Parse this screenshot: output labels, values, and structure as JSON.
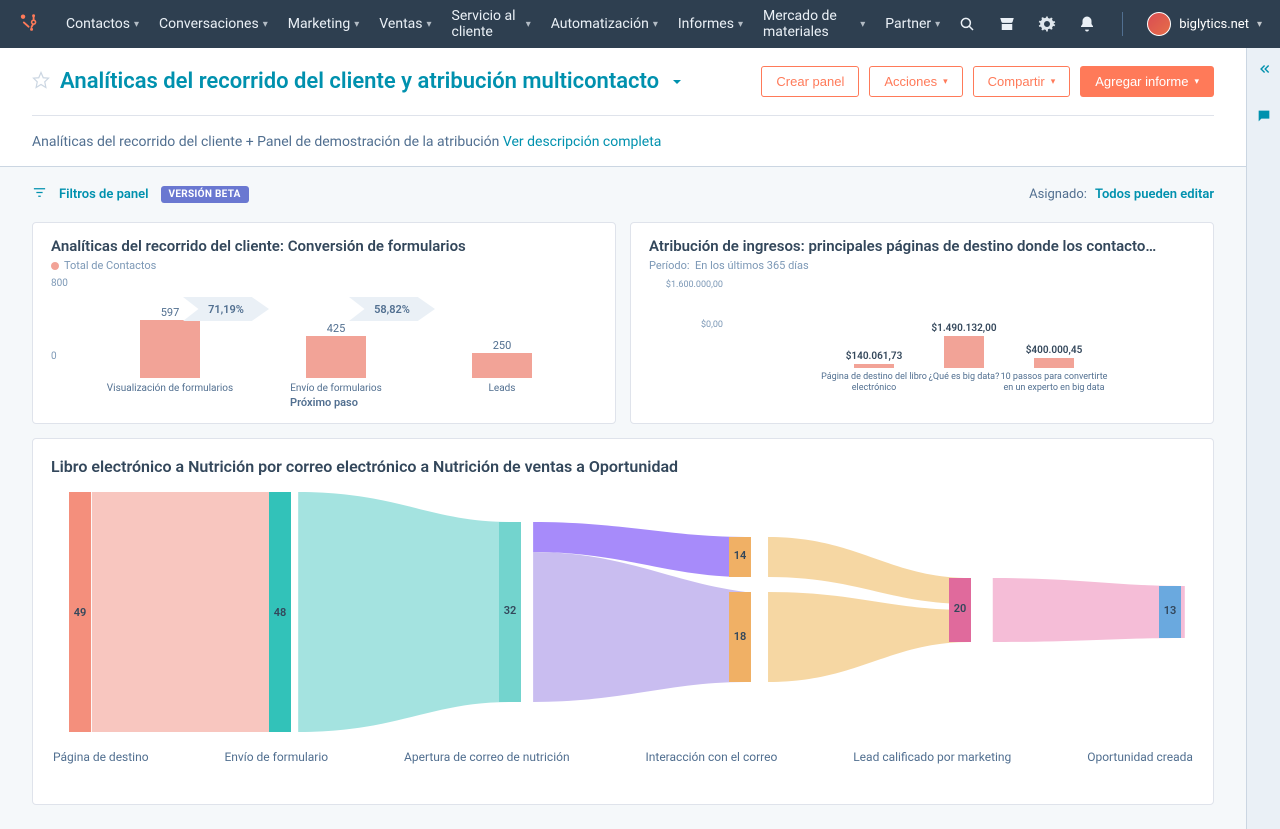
{
  "nav": {
    "items": [
      "Contactos",
      "Conversaciones",
      "Marketing",
      "Ventas",
      "Servicio al cliente",
      "Automatización",
      "Informes",
      "Mercado de materiales",
      "Partner"
    ],
    "account": "biglytics.net"
  },
  "header": {
    "title": "Analíticas del recorrido del cliente y atribución multicontacto",
    "buttons": {
      "create": "Crear panel",
      "actions": "Acciones",
      "share": "Compartir",
      "add_report": "Agregar informe"
    },
    "desc_prefix": "Analíticas del recorrido del cliente + Panel de demostración de la atribución ",
    "desc_link": "Ver descripción completa"
  },
  "filters": {
    "label": "Filtros de panel",
    "badge": "VERSIÓN BETA",
    "assigned_label": "Asignado:",
    "assigned_value": "Todos pueden editar"
  },
  "card1": {
    "title": "Analíticas del recorrido del cliente: Conversión de formularios",
    "legend": "Total de Contactos",
    "axis_max": "800",
    "axis_min": "0",
    "xaxis_title": "Próximo paso"
  },
  "card2": {
    "title": "Atribución de ingresos: principales páginas de destino donde los contacto…",
    "period_label": "Período:",
    "period_value": "En los últimos 365 días",
    "axis_top": "$1.600.000,00",
    "axis_bot": "$0,00"
  },
  "sankey": {
    "title": "Libro electrónico a Nutrición por correo electrónico a Nutrición de ventas a Oportunidad",
    "labels": [
      "Página de destino",
      "Envío de formulario",
      "Apertura de correo de nutrición",
      "Interacción con el correo",
      "Lead calificado por marketing",
      "Oportunidad creada"
    ]
  },
  "chart_data": [
    {
      "type": "bar",
      "title": "Analíticas del recorrido del cliente: Conversión de formularios",
      "ylabel": "Total de Contactos",
      "xlabel": "Próximo paso",
      "ylim": [
        0,
        800
      ],
      "categories": [
        "Visualización de formularios",
        "Envío de formularios",
        "Leads"
      ],
      "values": [
        597,
        425,
        250
      ],
      "conversion_rates": [
        "71,19%",
        "58,82%"
      ]
    },
    {
      "type": "bar",
      "title": "Atribución de ingresos: principales páginas de destino donde los contactos…",
      "period": "En los últimos 365 días",
      "ylim": [
        0,
        1600000
      ],
      "categories": [
        "Página de destino del libro electrónico",
        "¿Qué es big data?",
        "10 passos para convertirte en un experto en big data"
      ],
      "values_label": [
        "$140.061,73",
        "$1.490.132,00",
        "$400.000,45"
      ],
      "values": [
        140061.73,
        1490132.0,
        400000.45
      ]
    },
    {
      "type": "sankey",
      "title": "Libro electrónico a Nutrición por correo electrónico a Nutrición de ventas a Oportunidad",
      "nodes": [
        {
          "stage": "Página de destino",
          "value": 49
        },
        {
          "stage": "Envío de formulario",
          "value": 48
        },
        {
          "stage": "Apertura de correo de nutrición",
          "value": 32
        },
        {
          "stage": "Interacción con el correo",
          "split": [
            14,
            18
          ]
        },
        {
          "stage": "Lead calificado por marketing",
          "value": 20
        },
        {
          "stage": "Oportunidad creada",
          "value": 13
        }
      ]
    }
  ]
}
